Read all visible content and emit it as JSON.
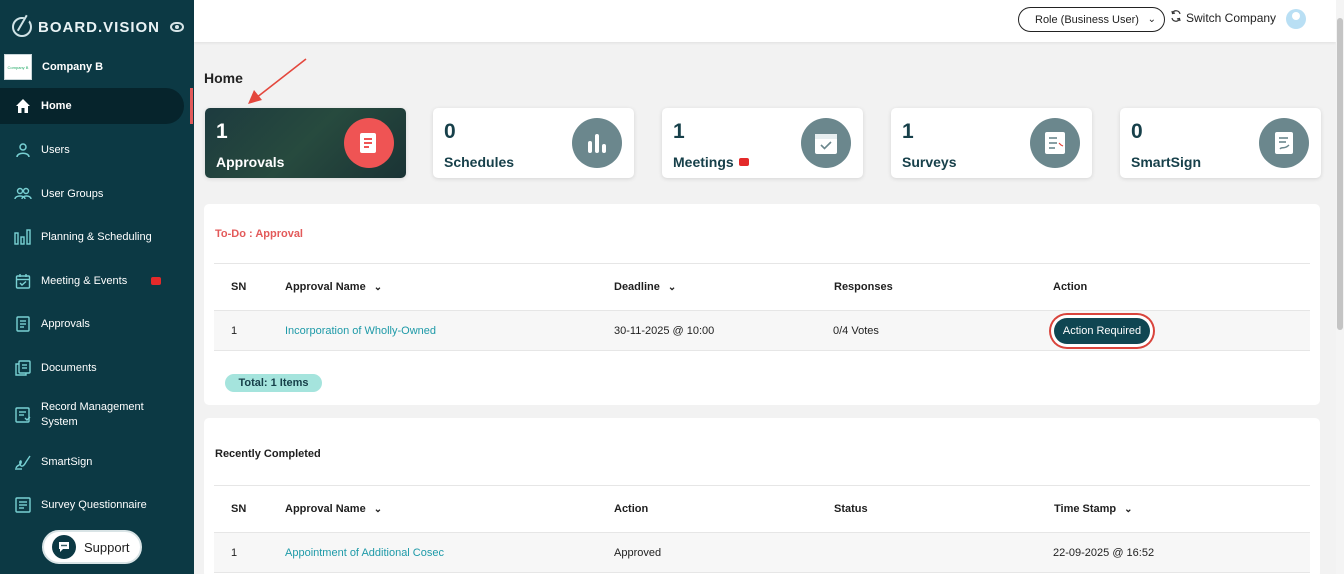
{
  "brand": {
    "logo_text": "BOARD.VISION"
  },
  "company": {
    "logo_text": "Company B",
    "name": "Company B"
  },
  "nav": {
    "items": [
      {
        "label": "Home",
        "icon": "home-icon",
        "active": true
      },
      {
        "label": "Users",
        "icon": "user-icon"
      },
      {
        "label": "User Groups",
        "icon": "user-groups-icon"
      },
      {
        "label": "Planning & Scheduling",
        "icon": "chart-icon"
      },
      {
        "label": "Meeting & Events",
        "icon": "calendar-icon",
        "badge": true
      },
      {
        "label": "Approvals",
        "icon": "document-list-icon"
      },
      {
        "label": "Documents",
        "icon": "documents-icon"
      },
      {
        "label": "Record Management System",
        "icon": "record-icon"
      },
      {
        "label": "SmartSign",
        "icon": "signature-icon"
      },
      {
        "label": "Survey Questionnaire",
        "icon": "survey-icon"
      }
    ]
  },
  "support": {
    "label": "Support"
  },
  "topbar": {
    "role": "Role (Business User)",
    "switch_company": "Switch Company"
  },
  "page": {
    "title": "Home"
  },
  "stats": [
    {
      "count": "1",
      "label": "Approvals",
      "icon": "approvals-icon",
      "selected": true
    },
    {
      "count": "0",
      "label": "Schedules",
      "icon": "bar-chart-icon"
    },
    {
      "count": "1",
      "label": "Meetings",
      "icon": "calendar-check-icon",
      "badge": true
    },
    {
      "count": "1",
      "label": "Surveys",
      "icon": "survey-checklist-icon"
    },
    {
      "count": "0",
      "label": "SmartSign",
      "icon": "smartsign-doc-icon"
    }
  ],
  "todo": {
    "title": "To-Do : Approval",
    "columns": [
      "SN",
      "Approval Name",
      "Deadline",
      "Responses",
      "Action"
    ],
    "rows": [
      {
        "sn": "1",
        "name": "Incorporation of Wholly-Owned",
        "deadline": "30-11-2025 @ 10:00",
        "responses": "0/4 Votes",
        "action": "Action Required"
      }
    ],
    "total": "Total: 1 Items"
  },
  "completed": {
    "title": "Recently Completed",
    "columns": [
      "SN",
      "Approval Name",
      "Action",
      "Status",
      "Time Stamp"
    ],
    "rows": [
      {
        "sn": "1",
        "name": "Appointment of Additional Cosec",
        "action": "Approved",
        "status": "",
        "timestamp": "22-09-2025 @ 16:52"
      }
    ]
  },
  "colors": {
    "sidebar": "#0c3944",
    "accent": "#1e9aa8",
    "alert": "#e35a5a"
  }
}
